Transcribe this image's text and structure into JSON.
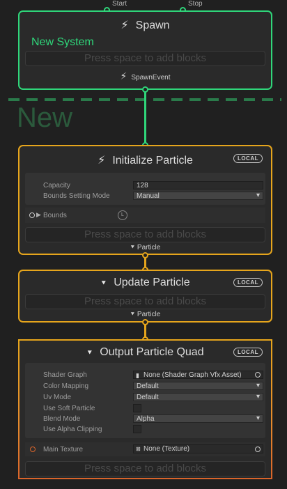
{
  "ports": {
    "start": "Start",
    "stop": "Stop"
  },
  "spawn": {
    "title": "Spawn",
    "system_name": "New System",
    "add_blocks": "Press space to add blocks",
    "event_label": "SpawnEvent"
  },
  "group_title": "New",
  "init": {
    "title": "Initialize Particle",
    "badge": "LOCAL",
    "capacity_label": "Capacity",
    "capacity_value": "128",
    "bounds_mode_label": "Bounds Setting Mode",
    "bounds_mode_value": "Manual",
    "bounds_label": "Bounds",
    "bounds_space": "L",
    "add_blocks": "Press space to add blocks",
    "flow_out": "Particle"
  },
  "update": {
    "title": "Update Particle",
    "badge": "LOCAL",
    "add_blocks": "Press space to add blocks",
    "flow_out": "Particle"
  },
  "output": {
    "title": "Output Particle Quad",
    "badge": "LOCAL",
    "shader_graph_label": "Shader Graph",
    "shader_graph_value": "None (Shader Graph Vfx Asset)",
    "color_mapping_label": "Color Mapping",
    "color_mapping_value": "Default",
    "uv_mode_label": "Uv Mode",
    "uv_mode_value": "Default",
    "soft_particle_label": "Use Soft Particle",
    "blend_mode_label": "Blend Mode",
    "blend_mode_value": "Alpha",
    "alpha_clip_label": "Use Alpha Clipping",
    "main_texture_label": "Main Texture",
    "main_texture_value": "None (Texture)",
    "add_blocks": "Press space to add blocks"
  },
  "colors": {
    "spawn_accent": "#2fd67a",
    "particle_accent": "#e6a51c",
    "output_end": "#d9642a",
    "group_border": "#2a7a4a"
  }
}
